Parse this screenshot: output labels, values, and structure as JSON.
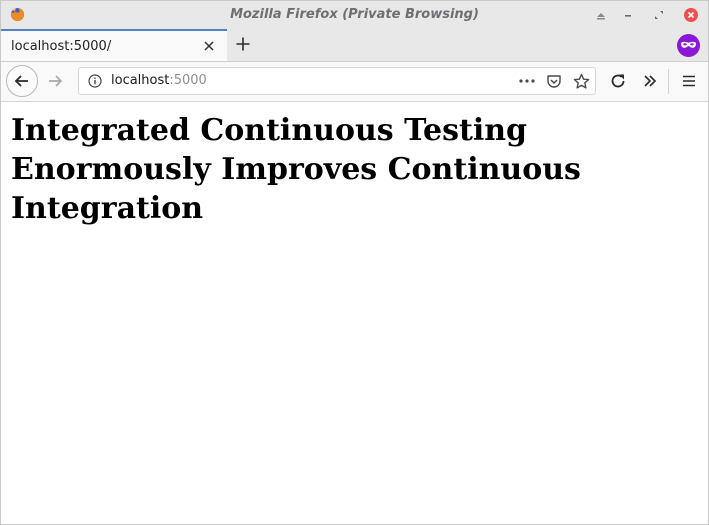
{
  "window": {
    "title": "Mozilla Firefox (Private Browsing)"
  },
  "tabs": [
    {
      "label": "localhost:5000/"
    }
  ],
  "urlbar": {
    "host": "localhost",
    "port": ":5000"
  },
  "page": {
    "heading": "Integrated Continuous Testing Enormously Improves Continuous Integration"
  },
  "colors": {
    "private_badge": "#8b18d6",
    "close_button": "#f0504d",
    "tab_accent": "#4f84c4"
  },
  "icons": {
    "app": "firefox-logo-icon",
    "minimize": "minimize-icon",
    "restore": "restore-icon",
    "maximize": "maximize-icon",
    "close": "close-icon",
    "new_tab": "plus-icon",
    "private": "private-browsing-mask-icon",
    "back": "arrow-left-icon",
    "forward": "arrow-right-icon",
    "info": "info-icon",
    "page_actions": "more-dots-icon",
    "pocket": "pocket-icon",
    "bookmark": "star-icon",
    "reload": "reload-icon",
    "overflow": "chevrons-right-icon",
    "menu": "hamburger-menu-icon"
  }
}
